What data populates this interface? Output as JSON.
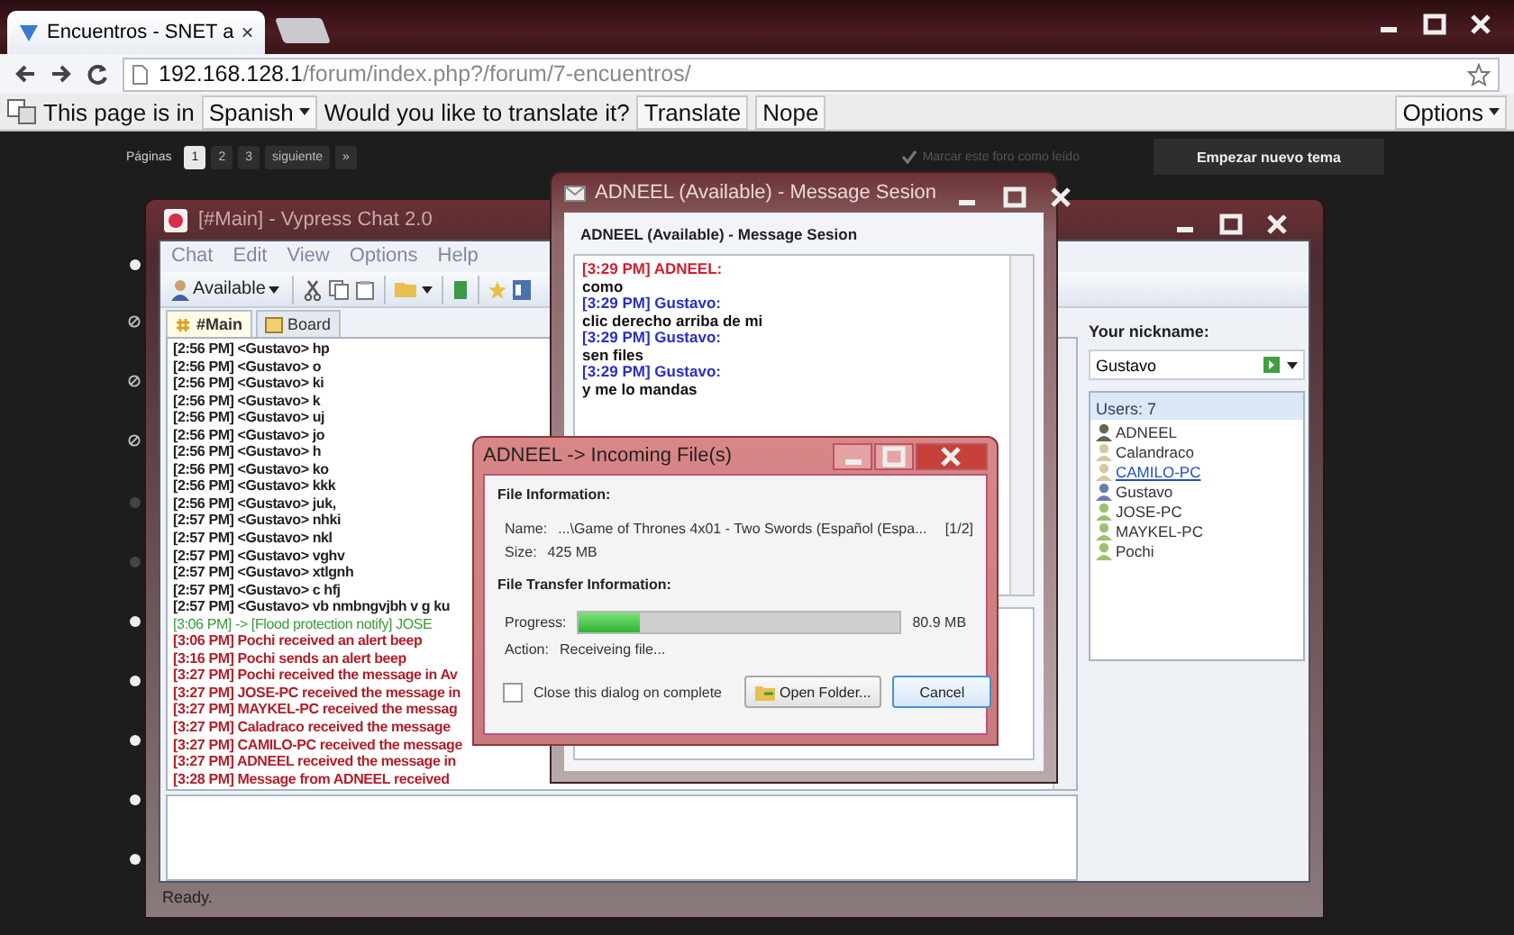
{
  "browser": {
    "tab": {
      "title": "Encuentros - SNET a",
      "close": "×"
    },
    "address": {
      "host": "192.168.128.1",
      "path": "/forum/index.php?/forum/7-encuentros/"
    },
    "translate_bar": {
      "prefix": "This page is in",
      "language": "Spanish",
      "question": "Would you like to translate it?",
      "buttons": [
        "Translate",
        "Nope"
      ],
      "options": "Options"
    }
  },
  "forum": {
    "pages_label": "Páginas",
    "pages": [
      {
        "label": "1",
        "selected": true
      },
      {
        "label": "2",
        "selected": false
      },
      {
        "label": "3",
        "selected": false
      },
      {
        "label": "siguiente",
        "selected": false
      },
      {
        "label": "»",
        "selected": false
      }
    ],
    "mark_read": "Marcar este foro como leído",
    "new_topic": "Empezar nuevo tema",
    "bullets": [
      {
        "kind": "dot"
      },
      {
        "kind": "blocked"
      },
      {
        "kind": "blocked"
      },
      {
        "kind": "blocked"
      },
      {
        "kind": "faint"
      },
      {
        "kind": "faint"
      },
      {
        "kind": "dot"
      },
      {
        "kind": "dot"
      },
      {
        "kind": "dot"
      },
      {
        "kind": "dot"
      },
      {
        "kind": "dot"
      }
    ]
  },
  "chat_window": {
    "title": "[#Main] - Vypress Chat 2.0",
    "menu": [
      "Chat",
      "Edit",
      "View",
      "Options",
      "Help"
    ],
    "status_button": "Available",
    "tabs": [
      {
        "label": "#Main",
        "selected": true
      },
      {
        "label": "Board",
        "selected": false
      }
    ],
    "log": [
      {
        "kind": "message",
        "text": "[2:56 PM] <Gustavo> hp"
      },
      {
        "kind": "message",
        "text": "[2:56 PM] <Gustavo> o"
      },
      {
        "kind": "message",
        "text": "[2:56 PM] <Gustavo> ki"
      },
      {
        "kind": "message",
        "text": "[2:56 PM] <Gustavo> k"
      },
      {
        "kind": "message",
        "text": "[2:56 PM] <Gustavo> uj"
      },
      {
        "kind": "message",
        "text": "[2:56 PM] <Gustavo> jo"
      },
      {
        "kind": "message",
        "text": "[2:56 PM] <Gustavo> h"
      },
      {
        "kind": "message",
        "text": "[2:56 PM] <Gustavo> ko"
      },
      {
        "kind": "message",
        "text": "[2:56 PM] <Gustavo> kkk"
      },
      {
        "kind": "message",
        "text": "[2:56 PM] <Gustavo> juk,"
      },
      {
        "kind": "message",
        "text": "[2:57 PM] <Gustavo> nhki"
      },
      {
        "kind": "message",
        "text": "[2:57 PM] <Gustavo> nkl"
      },
      {
        "kind": "message",
        "text": "[2:57 PM] <Gustavo> vghv"
      },
      {
        "kind": "message",
        "text": "[2:57 PM] <Gustavo> xtlgnh"
      },
      {
        "kind": "message",
        "text": "[2:57 PM] <Gustavo> c hfj"
      },
      {
        "kind": "message",
        "text": "[2:57 PM] <Gustavo> vb nmbngvjbh v g ku"
      },
      {
        "kind": "notify",
        "text": "[3:06 PM] -> [Flood protection notify] JOSE"
      },
      {
        "kind": "event",
        "text": "[3:06 PM] Pochi received an alert beep"
      },
      {
        "kind": "event",
        "text": "[3:16 PM] Pochi sends an alert beep"
      },
      {
        "kind": "event",
        "text": "[3:27 PM] Pochi received the message in Av"
      },
      {
        "kind": "event",
        "text": "[3:27 PM] JOSE-PC received the message in"
      },
      {
        "kind": "event",
        "text": "[3:27 PM] MAYKEL-PC received the messag"
      },
      {
        "kind": "event",
        "text": "[3:27 PM] Caladraco received the message"
      },
      {
        "kind": "event",
        "text": "[3:27 PM] CAMILO-PC received the message"
      },
      {
        "kind": "event",
        "text": "[3:27 PM] ADNEEL received the message in"
      },
      {
        "kind": "event",
        "text": "[3:28 PM] Message from ADNEEL received"
      }
    ],
    "status": "Ready.",
    "nickname_label": "Your nickname:",
    "nickname": "Gustavo",
    "users_header": "Users: 7",
    "users": [
      {
        "name": "ADNEEL",
        "color": "#5a6b52",
        "hovered": false
      },
      {
        "name": "Calandraco",
        "color": "#d8c8a0",
        "hovered": false
      },
      {
        "name": "CAMILO-PC",
        "color": "#d8c8a0",
        "hovered": true
      },
      {
        "name": "Gustavo",
        "color": "#6a7fb0",
        "hovered": false
      },
      {
        "name": "JOSE-PC",
        "color": "#9cc070",
        "hovered": false
      },
      {
        "name": "MAYKEL-PC",
        "color": "#9cc070",
        "hovered": false
      },
      {
        "name": "Pochi",
        "color": "#9cc070",
        "hovered": false
      }
    ]
  },
  "message_window": {
    "title": "ADNEEL (Available) - Message Sesion",
    "header": "ADNEEL (Available) - Message Sesion",
    "messages": [
      {
        "kind": "remote",
        "text": "[3:29 PM] ADNEEL:"
      },
      {
        "kind": "text",
        "text": "como"
      },
      {
        "kind": "local",
        "text": "[3:29 PM] Gustavo:"
      },
      {
        "kind": "text",
        "text": "clic derecho arriba de mi"
      },
      {
        "kind": "local",
        "text": "[3:29 PM] Gustavo:"
      },
      {
        "kind": "text",
        "text": "sen files"
      },
      {
        "kind": "local",
        "text": "[3:29 PM] Gustavo:"
      },
      {
        "kind": "text",
        "text": "y me lo mandas"
      }
    ]
  },
  "file_dialog": {
    "title": "ADNEEL -> Incoming File(s)",
    "file_section": "File Information:",
    "name_label": "Name:",
    "name": "...\\Game of Thrones 4x01 - Two Swords (Español (Espa...",
    "counter": "[1/2]",
    "size_label": "Size:",
    "size": "425 MB",
    "transfer_section": "File Transfer Information:",
    "progress_label": "Progress:",
    "progress": {
      "level": 0.19,
      "reading": "80.9 MB"
    },
    "action_label": "Action:",
    "action": "Receiveing file...",
    "close_on_complete": {
      "label": "Close this dialog on complete",
      "checked": false
    },
    "buttons": [
      {
        "kind": "folder",
        "label": "Open Folder...",
        "default": false
      },
      {
        "kind": "plain",
        "label": "Cancel",
        "default": true
      }
    ]
  }
}
